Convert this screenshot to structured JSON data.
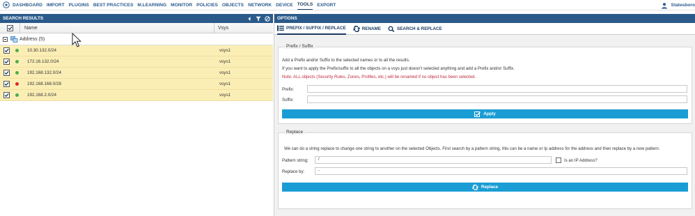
{
  "nav": {
    "items": [
      "DASHBOARD",
      "IMPORT",
      "PLUGINS",
      "BEST PRACTICES",
      "M.LEARNING",
      "MONITOR",
      "POLICIES",
      "OBJECTS",
      "NETWORK",
      "DEVICE",
      "TOOLS",
      "EXPORT"
    ],
    "active": "TOOLS",
    "user": "Statesboro"
  },
  "results": {
    "title": "SEARCH RESULTS",
    "columns": {
      "name": "Name",
      "vsys": "Vsys"
    },
    "group_label": "Address (5)",
    "rows": [
      {
        "name": "10.30.132.0/24",
        "vsys": "vsys1",
        "status_color": "#4cae4c"
      },
      {
        "name": "172.16.132.0/24",
        "vsys": "vsys1",
        "status_color": "#4cae4c"
      },
      {
        "name": "192.168.132.0/24",
        "vsys": "vsys1",
        "status_color": "#4cae4c"
      },
      {
        "name": "192.168.168.0/28",
        "vsys": "vsys1",
        "status_color": "#d9262e"
      },
      {
        "name": "192.168.2.0/24",
        "vsys": "vsys1",
        "status_color": "#4cae4c"
      }
    ]
  },
  "options": {
    "title": "OPTIONS",
    "tabs": [
      "PREFIX / SUFFIX / REPLACE",
      "RENAME",
      "SEARCH & REPLACE"
    ],
    "prefix_suffix": {
      "legend": "Prefix / Suffix",
      "line1": "Add a Prefix and/or Suffix to the selected names or to all the results.",
      "line2": "If you want to apply the Prefix/suffix to all the objects on a vsys just doesn't selected anything and add a Prefix and/or Suffix.",
      "note": "Note: ALL objects (Security Rules, Zones, Profiles, etc.) will be renamed if no object has been selected.",
      "prefix_label": "Prefix:",
      "prefix_value": "",
      "suffix_label": "Suffix:",
      "suffix_value": "",
      "apply_label": "Apply"
    },
    "replace": {
      "legend": "Replace",
      "description": "We can do a string replace to change one string to another on the selected Objects. First search by a pattern string, this can be a name or Ip address for the address and then replace by a new pattern.",
      "pattern_label": "Pattern string:",
      "pattern_value": "/",
      "is_ip_label": "Is an IP Address?",
      "replace_by_label": "Replace by:",
      "replace_by_value": "-",
      "replace_button": "Replace"
    }
  },
  "colors": {
    "header_bar": "#2b5a8a",
    "row_highlight": "#fbeeb5",
    "button": "#1a9dd4",
    "note": "#c0283b"
  }
}
